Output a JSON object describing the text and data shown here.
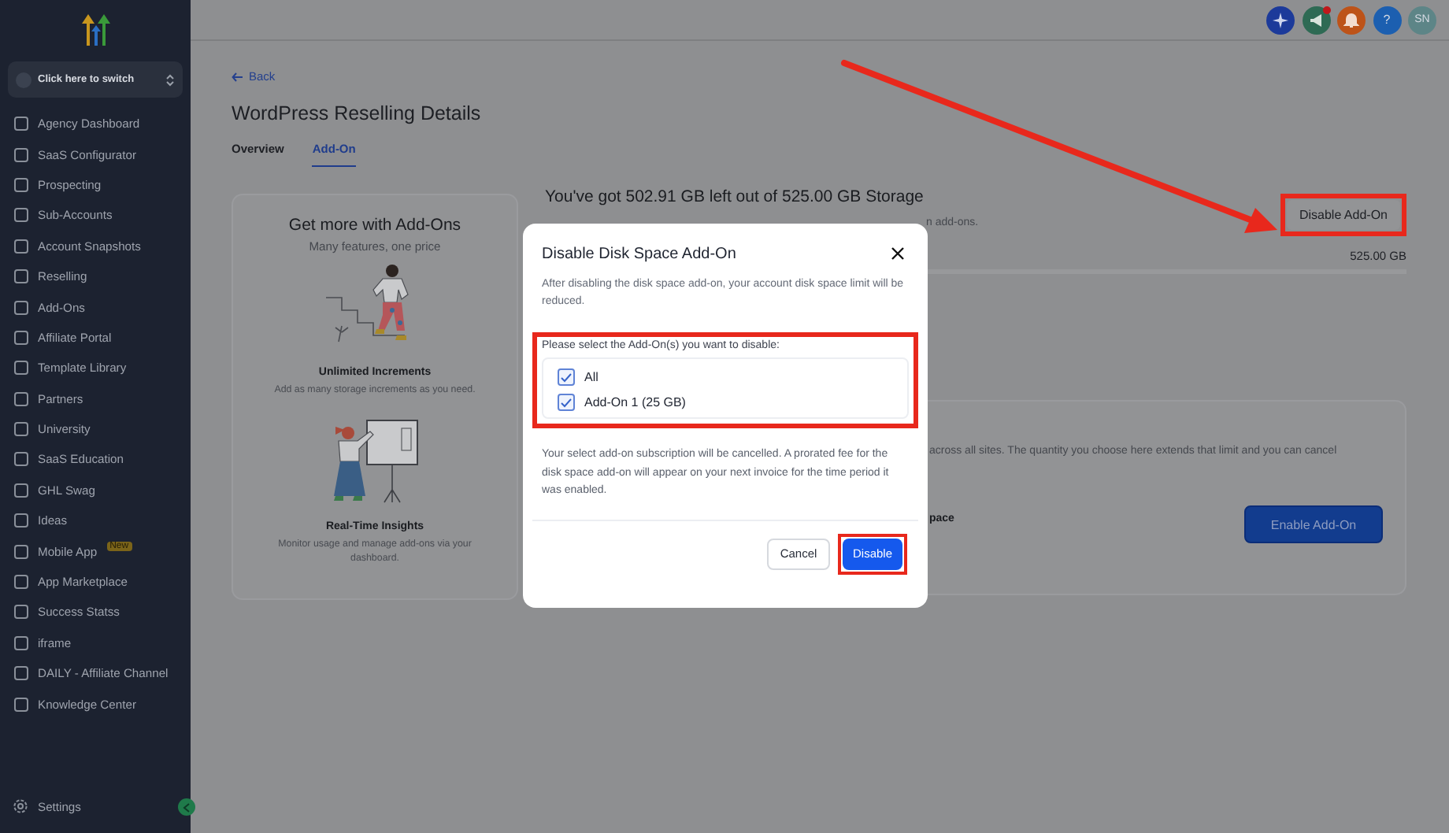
{
  "sidebar": {
    "switcher": {
      "label": "Click here to switch"
    },
    "items": [
      {
        "label": "Agency Dashboard",
        "selected": false
      },
      {
        "label": "SaaS Configurator",
        "selected": false
      },
      {
        "label": "Prospecting",
        "selected": false
      },
      {
        "label": "Sub-Accounts",
        "selected": false
      },
      {
        "label": "Account Snapshots",
        "selected": false
      },
      {
        "label": "Reselling",
        "selected": false
      },
      {
        "label": "Add-Ons",
        "selected": false
      },
      {
        "label": "Affiliate Portal",
        "selected": false
      },
      {
        "label": "Template Library",
        "selected": false
      },
      {
        "label": "Partners",
        "selected": false
      },
      {
        "label": "University",
        "selected": false
      },
      {
        "label": "SaaS Education",
        "selected": false
      },
      {
        "label": "GHL Swag",
        "selected": false
      },
      {
        "label": "Ideas",
        "selected": false
      },
      {
        "label": "Mobile App",
        "selected": false,
        "badge": "New"
      },
      {
        "label": "App Marketplace",
        "selected": false
      },
      {
        "label": "Success Statss",
        "selected": false
      },
      {
        "label": "iframe",
        "selected": false
      },
      {
        "label": "DAILY - Affiliate Channel",
        "selected": false
      },
      {
        "label": "Knowledge Center",
        "selected": false
      }
    ],
    "settings": "Settings"
  },
  "topbar": {
    "help": "?",
    "avatar": "SN"
  },
  "page": {
    "back": "Back",
    "title": "WordPress Reselling Details",
    "tabs": [
      {
        "label": "Overview",
        "selected": false
      },
      {
        "label": "Add-On",
        "selected": true
      }
    ]
  },
  "promo": {
    "title": "Get more with Add-Ons",
    "subtitle": "Many features, one price",
    "features": [
      {
        "title": "Unlimited Increments",
        "text": "Add as many storage increments as you need."
      },
      {
        "title": "Real-Time Insights",
        "text": "Monitor usage and manage add-ons via your dashboard."
      }
    ]
  },
  "storage": {
    "heading": "You've got 502.91 GB left out of 525.00 GB Storage",
    "subtitle": "n add-ons.",
    "action": "Disable Add-On",
    "total": "525.00 GB"
  },
  "addon_card": {
    "text": "across all sites. The quantity you choose here extends that limit and you can cancel",
    "label": "pace",
    "action": "Enable Add-On"
  },
  "modal": {
    "title": "Disable Disk Space Add-On",
    "description": "After disabling the disk space add-on, your account disk space limit will be reduced.",
    "prompt": "Please select the Add-On(s) you want to disable:",
    "options": [
      {
        "label": "All",
        "checked": true
      },
      {
        "label": "Add-On 1 (25 GB)",
        "checked": true
      }
    ],
    "note": "Your select add-on subscription will be cancelled. A prorated fee for the disk space add-on will appear on your next invoice for the time period it was enabled.",
    "buttons": [
      {
        "label": "Cancel",
        "kind": "secondary"
      },
      {
        "label": "Disable",
        "kind": "primary"
      }
    ]
  }
}
